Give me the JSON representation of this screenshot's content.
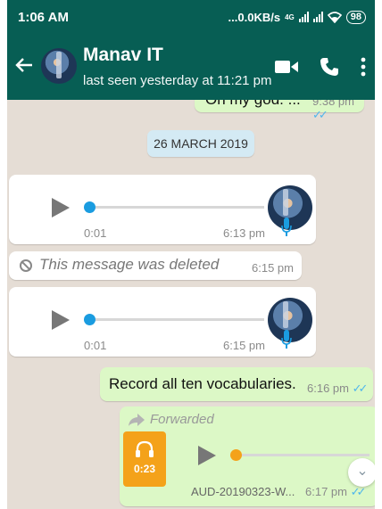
{
  "status_bar": {
    "time": "1:06 AM",
    "network_speed": "...0.0KB/s",
    "network_type": "4G",
    "battery": "98"
  },
  "header": {
    "contact_name": "Manav IT",
    "last_seen": "last seen yesterday at 11:21 pm",
    "icons": [
      "back-arrow-icon",
      "video-call-icon",
      "voice-call-icon",
      "more-options-icon"
    ]
  },
  "colors": {
    "header": "#075e54",
    "chat_background": "#e5ddd5",
    "outgoing_bubble": "#dcf8c6",
    "incoming_bubble": "#ffffff",
    "read_ticks": "#4fb6ec",
    "voice_accent": "#1a9ce0",
    "audio_file_accent": "#f4a21a"
  },
  "messages": {
    "prev_out": {
      "text": "Oh my god. ...",
      "time": "9:38 pm"
    },
    "date_divider": "26 MARCH 2019",
    "voice_1": {
      "duration": "0:01",
      "time": "6:13 pm"
    },
    "deleted": {
      "text": "This message was deleted",
      "time": "6:15 pm"
    },
    "voice_2": {
      "duration": "0:01",
      "time": "6:15 pm"
    },
    "text_out": {
      "text": "Record all ten vocabularies.",
      "time": "6:16 pm"
    },
    "forwarded_audio": {
      "forwarded_label": "Forwarded",
      "duration": "0:23",
      "file_name": "AUD-20190323-W...",
      "time": "6:17 pm"
    }
  }
}
